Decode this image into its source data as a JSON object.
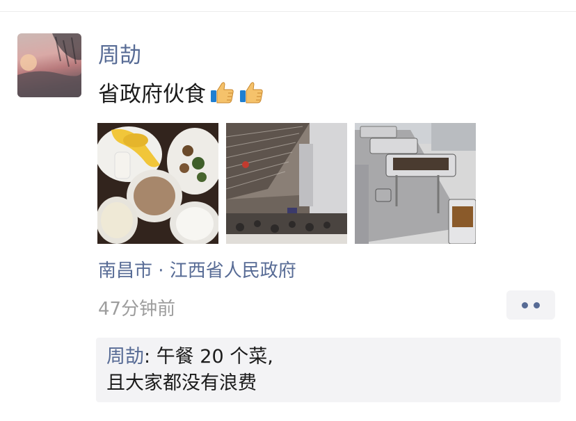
{
  "post": {
    "author": "周劼",
    "text": "省政府伙食",
    "emojis": [
      "thumbs-up-icon",
      "thumbs-up-icon"
    ],
    "photos": [
      {
        "name": "photo-meal-tray"
      },
      {
        "name": "photo-canteen-hall"
      },
      {
        "name": "photo-buffet-counter"
      }
    ],
    "location": "南昌市 · 江西省人民政府",
    "time": "47分钟前"
  },
  "comment": {
    "commenter": "周劼",
    "separator": ": ",
    "line1": "午餐 20 个菜,",
    "line2": "且大家都没有浪费"
  },
  "colors": {
    "name_link": "#576b95",
    "text": "#1b1b1b",
    "time": "#9d9d9d",
    "comment_bg": "#f3f3f5"
  }
}
